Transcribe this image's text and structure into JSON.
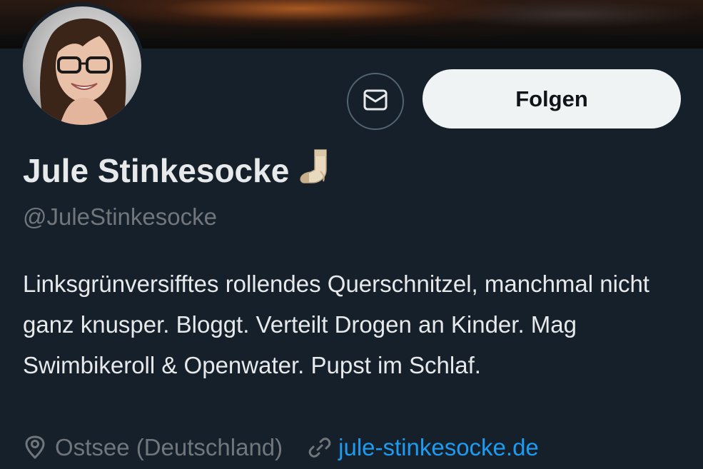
{
  "profile": {
    "display_name": "Jule Stinkesocke",
    "name_emoji": "sock-emoji",
    "handle": "@JuleStinkesocke",
    "bio": "Linksgrünversifftes rollendes Querschnitzel, manchmal nicht ganz knusper. Bloggt. Verteilt Drogen an Kinder. Mag Swimbikeroll & Openwater. Pupst im Schlaf.",
    "location": "Ostsee (Deutschland)",
    "website": "jule-stinkesocke.de"
  },
  "actions": {
    "message_icon": "mail-icon",
    "follow_label": "Folgen"
  },
  "colors": {
    "background": "#15202b",
    "text_primary": "#e7e9ea",
    "text_secondary": "#71767b",
    "link": "#1d9bf0",
    "follow_button_bg": "#eff3f4",
    "follow_button_text": "#0f1419"
  }
}
